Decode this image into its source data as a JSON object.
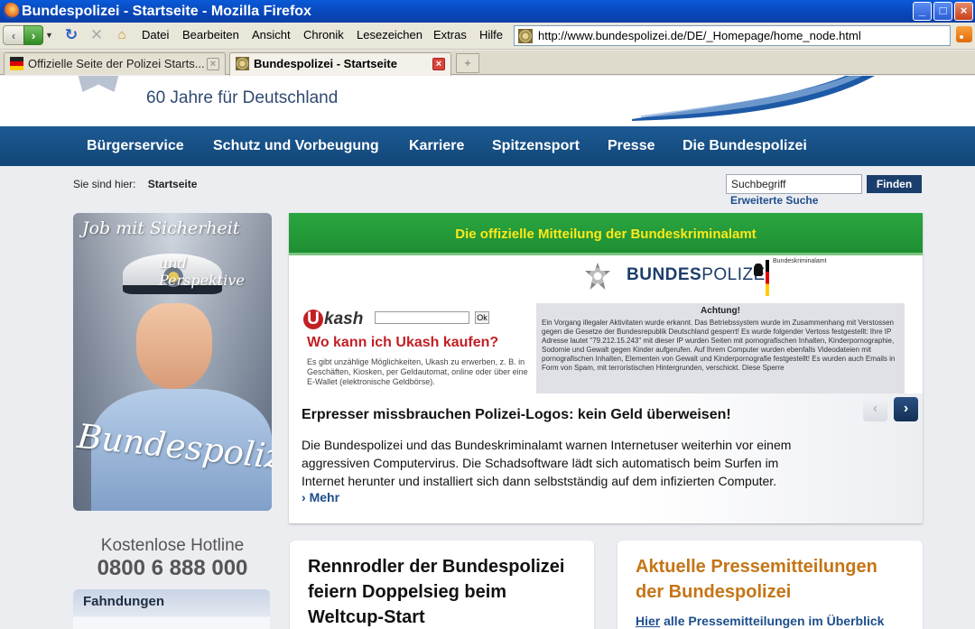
{
  "window": {
    "title": "Bundespolizei - Startseite - Mozilla Firefox"
  },
  "browser": {
    "menu": [
      "Datei",
      "Bearbeiten",
      "Ansicht",
      "Chronik",
      "Lesezeichen",
      "Extras",
      "Hilfe"
    ],
    "url": "http://www.bundespolizei.de/DE/_Homepage/home_node.html",
    "tabs": [
      {
        "label": "Offizielle Seite der Polizei Starts..."
      },
      {
        "label": "Bundespolizei - Startseite"
      }
    ],
    "new_tab_symbol": "+"
  },
  "header": {
    "slogan": "60 Jahre für Deutschland"
  },
  "nav": [
    "Bürgerservice",
    "Schutz und Vorbeugung",
    "Karriere",
    "Spitzensport",
    "Presse",
    "Die Bundespolizei"
  ],
  "breadcrumb": {
    "label": "Sie sind hier:",
    "current": "Startseite"
  },
  "search": {
    "value": "Suchbegriff",
    "button": "Finden",
    "advanced": "Erweiterte Suche"
  },
  "promo": {
    "line1": "Job mit Sicherheit",
    "line2": "und Perspektive",
    "line3": "Bundespolizist"
  },
  "hotline": {
    "label": "Kostenlose Hotline",
    "number": "0800 6 888 000"
  },
  "fahndungen": {
    "title": "Fahndungen"
  },
  "teaser": {
    "green_banner": "Die offizielle Mitteilung der Bundeskriminalamt",
    "bp_logo_text_bold": "BUNDES",
    "bp_logo_text": "POLIZEI",
    "bka_label": "Bundeskriminalamt",
    "ukash_logo": "kash",
    "ukash_logo_letter": "U",
    "ukash_ok": "Ok",
    "ukash_question": "Wo kann ich Ukash kaufen?",
    "ukash_desc": "Es gibt unzählige Möglichkeiten, Ukash zu erwerben, z. B. in Geschäften, Kiosken, per Geldautomat, online oder über eine E-Wallet (elektronische Geldbörse).",
    "warn_title": "Achtung!",
    "warn_text": "Ein Vorgang illegaler Aktivitaten wurde erkannt. Das Betriebssystem wurde im Zusammenhang mit Verstossen gegen die Gesetze der Bundesrepublik Deutschland gesperrt! Es wurde folgender Vertoss festgestellt: Ihre IP Adresse lautet \"79.212.15.243\" mit dieser IP wurden Seiten mit pornografischen Inhalten, Kinderpornographie, Sodomie und Gewalt gegen Kinder aufgerufen. Auf Ihrem Computer wurden ebenfalls Videodateien mit pornografischen Inhalten, Elementen von Gewalt und Kinderpornografie festgestellt! Es wurden auch Emails in Form von Spam, mit terroristischen Hintergrunden, verschickt. Diese Sperre",
    "headline": "Erpresser missbrauchen Polizei-Logos: kein Geld überweisen!",
    "body": "Die Bundespolizei und das Bundeskriminalamt warnen Internetuser weiterhin vor einem aggressiven Computervirus. Die Schadsoftware lädt sich automatisch beim Surfen im Internet herunter und installiert sich dann selbstständig auf dem infizierten Computer.",
    "more": "Mehr"
  },
  "cards": {
    "news_title": "Rennrodler der Bundespolizei feiern Doppelsieg beim Weltcup-Start",
    "press_title": "Aktuelle Pressemitteilungen der Bundespolizei",
    "press_link_word": "Hier",
    "press_link_rest": " alle Pressemitteilungen im Überblick"
  },
  "colors": {
    "nav_blue": "#124678",
    "green_banner": "#1e8f32",
    "banner_text": "#ffe819",
    "press_orange": "#c57516",
    "link_blue": "#1d4e8c"
  }
}
